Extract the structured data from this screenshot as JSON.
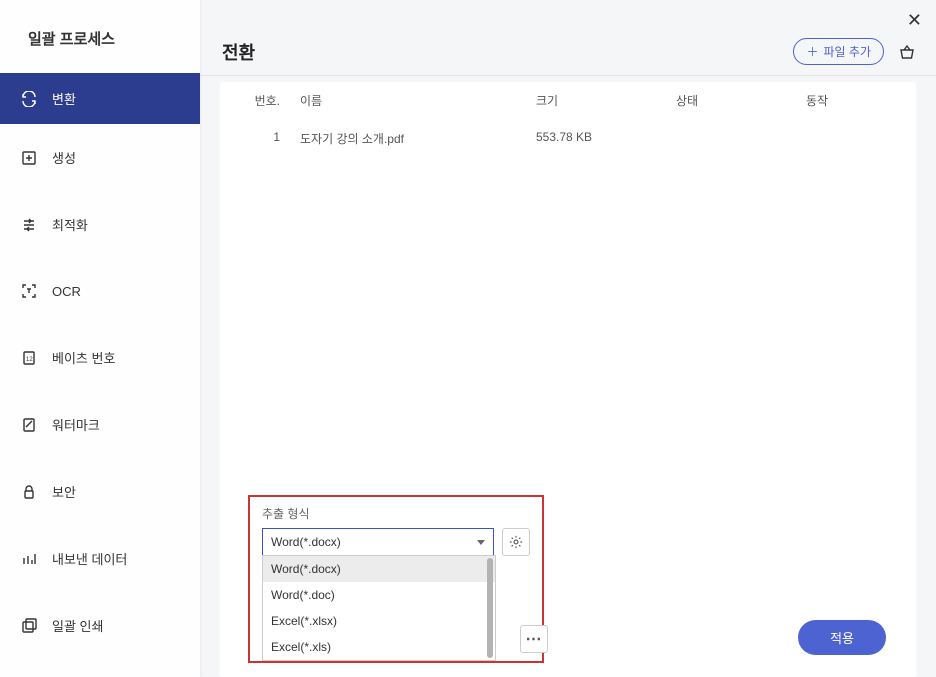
{
  "sidebar": {
    "title": "일괄 프로세스",
    "items": [
      {
        "label": "변환",
        "icon": "convert-icon",
        "active": true
      },
      {
        "label": "생성",
        "icon": "create-icon",
        "active": false
      },
      {
        "label": "최적화",
        "icon": "optimize-icon",
        "active": false
      },
      {
        "label": "OCR",
        "icon": "ocr-icon",
        "active": false
      },
      {
        "label": "베이츠 번호",
        "icon": "bates-icon",
        "active": false
      },
      {
        "label": "워터마크",
        "icon": "watermark-icon",
        "active": false
      },
      {
        "label": "보안",
        "icon": "security-icon",
        "active": false
      },
      {
        "label": "내보낸 데이터",
        "icon": "export-icon",
        "active": false
      },
      {
        "label": "일괄 인쇄",
        "icon": "print-icon",
        "active": false
      }
    ]
  },
  "header": {
    "title": "전환",
    "add_file_label": "파일 추가"
  },
  "table": {
    "columns": {
      "no": "번호.",
      "name": "이름",
      "size": "크기",
      "status": "상태",
      "action": "동작"
    },
    "rows": [
      {
        "no": "1",
        "name": "도자기 강의 소개.pdf",
        "size": "553.78 KB",
        "status": "",
        "action": ""
      }
    ]
  },
  "bottom": {
    "format_label": "추출 형식",
    "selected_format": "Word(*.docx)",
    "options": [
      "Word(*.docx)",
      "Word(*.doc)",
      "Excel(*.xlsx)",
      "Excel(*.xls)"
    ],
    "apply_label": "적용"
  }
}
